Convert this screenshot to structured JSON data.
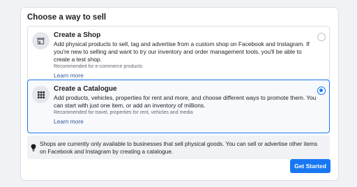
{
  "dialog": {
    "title": "Choose a way to sell",
    "options": [
      {
        "title": "Create a Shop",
        "icon": "shop-icon",
        "description": "Add physical products to sell, tag and advertise from a custom shop on Facebook and Instagram. If you're new to selling and want to try our inventory and order management tools, you'll be able to create a test shop.",
        "recommended": "Recommended for e-commerce products",
        "learn_more": "Learn more",
        "selected": false
      },
      {
        "title": "Create a Catalogue",
        "icon": "catalogue-grid-icon",
        "description": "Add products, vehicles, properties for rent and more, and choose different ways to promote them. You can start with just one item, or add an inventory of millions.",
        "recommended": "Recommended for travel, properties for rent, vehicles and media",
        "learn_more": "Learn more",
        "selected": true
      }
    ],
    "notice": {
      "icon": "lightbulb-icon",
      "text": "Shops are currently only available to businesses that sell physical goods. You can sell or advertise other items on Facebook and Instagram by creating a catalogue."
    },
    "primary_button": "Get Started"
  },
  "colors": {
    "accent": "#1877f2",
    "link": "#385898",
    "background": "#f0f2f5"
  }
}
